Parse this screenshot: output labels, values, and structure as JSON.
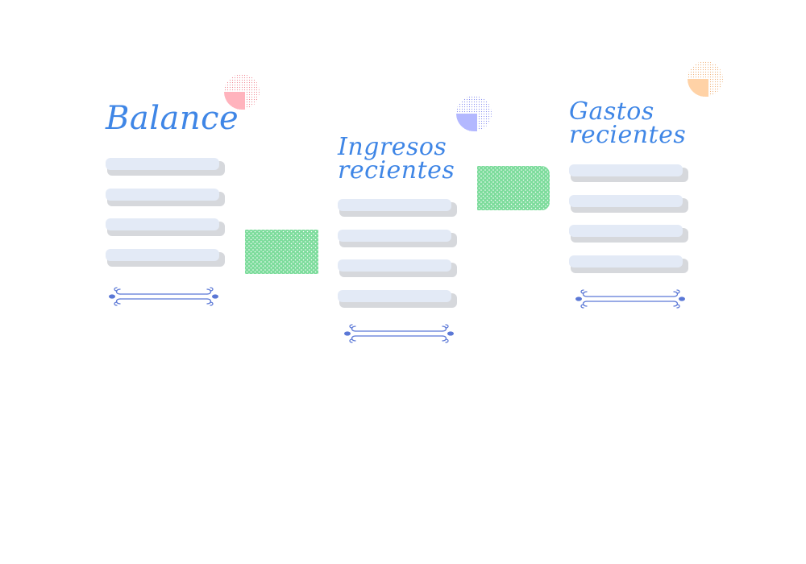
{
  "panels": [
    {
      "id": "balance",
      "title": "Balance"
    },
    {
      "id": "ingresos",
      "title": "Ingresos\nrecientes"
    },
    {
      "id": "gastos",
      "title": "Gastos\nrecientes"
    }
  ],
  "colors": {
    "title": "#3f86e6",
    "row_face": "#e3eaf6",
    "row_shadow": "#d6d8dc",
    "divider": "#5b78d6",
    "card_green": "#7ddc9c",
    "blob_red": "#ffb3bd",
    "blob_blue": "#b3b8ff",
    "blob_orange": "#ffd2a6"
  },
  "icons": {
    "divider": "ornamental-divider-icon",
    "blob": "dotted-circle-blob-icon"
  }
}
